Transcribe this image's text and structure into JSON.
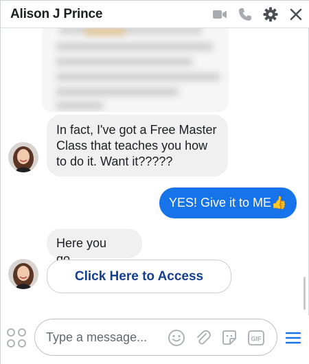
{
  "window": {
    "title": "Alison J Prince",
    "icons": [
      "video-camera-icon",
      "phone-icon",
      "gear-icon",
      "close-icon"
    ]
  },
  "conversation": {
    "messages": [
      {
        "from": "contact",
        "type": "image",
        "content": "blurred image"
      },
      {
        "from": "contact",
        "type": "text",
        "lines": [
          "In fact, I've got a Free Master",
          "Class that teaches you how",
          "to do it. Want it?????"
        ]
      },
      {
        "from": "me",
        "type": "text",
        "text": "YES! Give it to ME",
        "emoji": "👍"
      },
      {
        "from": "contact",
        "type": "text",
        "text": "Here you go..."
      },
      {
        "from": "contact",
        "type": "button",
        "label": "Click Here to Access"
      }
    ]
  },
  "composer": {
    "placeholder": "Type a message...",
    "icons": [
      "apps-icon",
      "emoji-icon",
      "attachment-icon",
      "sticker-icon",
      "gif-icon",
      "menu-icon"
    ],
    "gif_label": "GIF"
  },
  "colors": {
    "outgoing_bubble": "#1773ea",
    "incoming_bubble": "#f0f0f0",
    "access_button_text": "#14408f",
    "icon_gray": "#8d949e"
  }
}
